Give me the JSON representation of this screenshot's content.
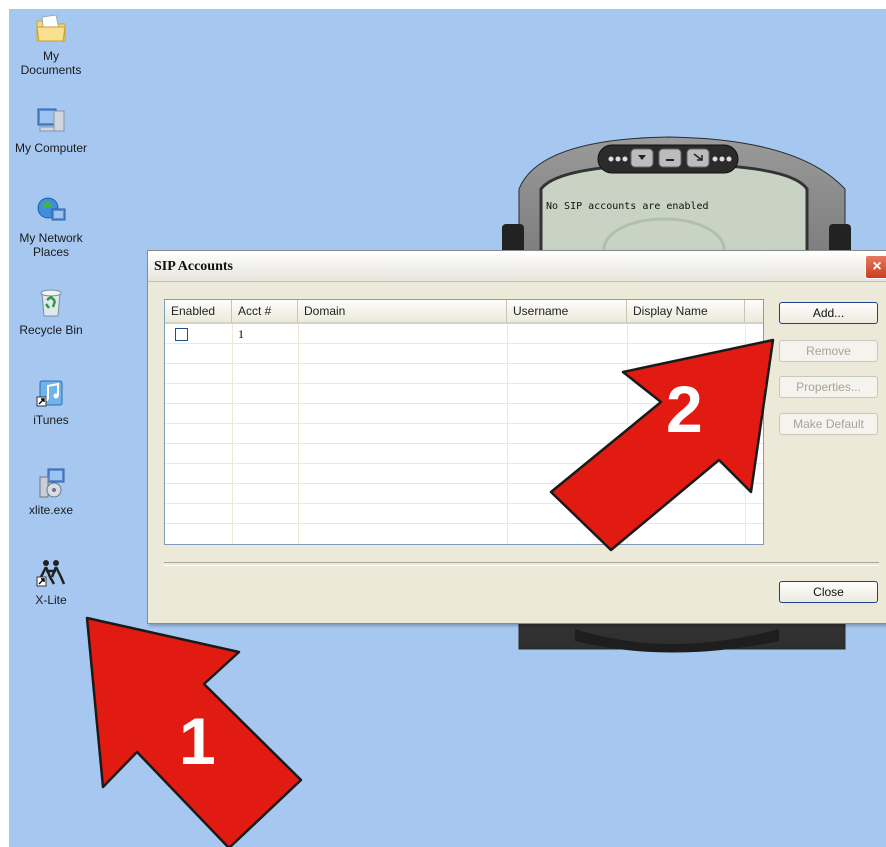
{
  "desktop_icons": [
    {
      "label": "My Documents",
      "icon": "folder-icon"
    },
    {
      "label": "My Computer",
      "icon": "computer-icon"
    },
    {
      "label": "My Network Places",
      "icon": "network-icon"
    },
    {
      "label": "Recycle Bin",
      "icon": "recycle-bin-icon"
    },
    {
      "label": "iTunes",
      "icon": "itunes-icon"
    },
    {
      "label": "xlite.exe",
      "icon": "installer-icon"
    },
    {
      "label": "X-Lite",
      "icon": "x-lite-icon"
    }
  ],
  "phone": {
    "display_text": "No SIP accounts are enabled"
  },
  "dialog": {
    "title": "SIP Accounts",
    "columns": [
      "Enabled",
      "Acct #",
      "Domain",
      "Username",
      "Display Name"
    ],
    "rows": [
      {
        "enabled": false,
        "acct": "1",
        "domain": "",
        "username": "",
        "display_name": ""
      }
    ],
    "buttons": {
      "add": "Add...",
      "remove": "Remove",
      "properties": "Properties...",
      "make_default": "Make Default",
      "close": "Close"
    }
  },
  "annotations": {
    "arrow1": "1",
    "arrow2": "2"
  },
  "colors": {
    "desktop": "#a6c8f0",
    "arrow": "#e11a12",
    "dialog": "#ece9d8"
  }
}
